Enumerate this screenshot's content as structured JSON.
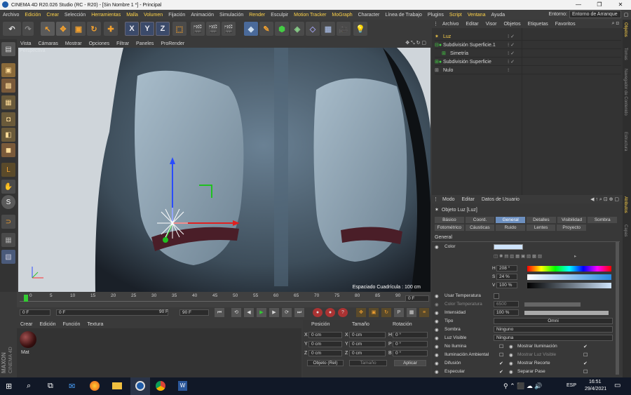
{
  "window": {
    "title": "CINEMA 4D R20.026 Studio (RC - R20) - [Sin Nombre 1 *] - Principal",
    "min": "—",
    "max": "❐",
    "close": "✕"
  },
  "menu": [
    "Archivo",
    "Edición",
    "Crear",
    "Selección",
    "Herramientas",
    "Malla",
    "Volumen",
    "Fijación",
    "Animación",
    "Simulación",
    "Render",
    "Esculpir",
    "Motion Tracker",
    "MoGraph",
    "Character",
    "Línea de Trabajo",
    "Plugins",
    "Script",
    "Ventana",
    "Ayuda"
  ],
  "environment": {
    "label": "Entorno:",
    "value": "Entorno de Arranque"
  },
  "viewport": {
    "menu": [
      "Vista",
      "Cámaras",
      "Mostrar",
      "Opciones",
      "Filtrar",
      "Paneles",
      "ProRender"
    ],
    "label": "Perspectiva",
    "grid_spacing": "Espaciado Cuadrícula : 100 cm"
  },
  "timeline": {
    "ticks": [
      "0",
      "5",
      "10",
      "15",
      "20",
      "25",
      "30",
      "35",
      "40",
      "45",
      "50",
      "55",
      "60",
      "65",
      "70",
      "75",
      "80",
      "85",
      "90"
    ],
    "end_frame": "0 F",
    "current_frame": "0 F",
    "start_field": "0 F",
    "range_end": "90 F",
    "max_frame": "90 F"
  },
  "materials": {
    "menu": [
      "Crear",
      "Edición",
      "Función",
      "Textura"
    ],
    "items": [
      {
        "name": "Mat"
      }
    ]
  },
  "coords": {
    "headers": [
      "Posición",
      "Tamaño",
      "Rotación"
    ],
    "rows": [
      {
        "a": "X",
        "pos": "0 cm",
        "b": "X",
        "size": "0 cm",
        "c": "H",
        "rot": "0 °"
      },
      {
        "a": "Y",
        "pos": "0 cm",
        "b": "Y",
        "size": "0 cm",
        "c": "P",
        "rot": "0 °"
      },
      {
        "a": "Z",
        "pos": "0 cm",
        "b": "Z",
        "size": "0 cm",
        "c": "B",
        "rot": "0 °"
      }
    ],
    "mode": "Objeto (Rel)",
    "size_mode": "Tamaño",
    "apply": "Aplicar"
  },
  "objects": {
    "menu": [
      "Archivo",
      "Editar",
      "Visor",
      "Objetos",
      "Etiquetas",
      "Favoritos"
    ],
    "items": [
      "Luz",
      "Subdivisión Superficie.1",
      "Simetría",
      "Subdivisión Superficie",
      "Nulo"
    ]
  },
  "attributes": {
    "menu": [
      "Modo",
      "Editar",
      "Datos de Usuario"
    ],
    "object_title": "Objeto Luz [Luz]",
    "tabs1": [
      "Básico",
      "Coord.",
      "General",
      "Detalles",
      "Visibilidad",
      "Sombra"
    ],
    "tabs2": [
      "Fotométrico",
      "Cáusticas",
      "Ruido",
      "Lentes",
      "Proyecto"
    ],
    "section": "General",
    "color_label": "Color",
    "hsv": [
      {
        "k": "H",
        "v": "208 °"
      },
      {
        "k": "S",
        "v": "24 %"
      },
      {
        "k": "V",
        "v": "100 %"
      }
    ],
    "use_temp": "Usar Temperatura",
    "color_temp": {
      "label": "Color Temperatura",
      "value": "6500"
    },
    "intensity": {
      "label": "Intensidad",
      "value": "100 %"
    },
    "type": {
      "label": "Tipo",
      "value": "Omni"
    },
    "shadow": {
      "label": "Sombra",
      "value": "Ninguno"
    },
    "visible_light": {
      "label": "Luz Visible",
      "value": "Ninguna"
    },
    "checks_left": [
      "No Ilumina",
      "Iluminación Ambiental",
      "Difusión",
      "Especular"
    ],
    "checks_right": [
      "Mostrar Iluminación",
      "Mostrar Luz Visible",
      "Mostrar Recorte",
      "Separar Pase"
    ]
  },
  "right_tabs": [
    "Objetos",
    "Tomas",
    "Navegador de Contenido",
    "Estructura",
    "Atributos",
    "Capas"
  ],
  "taskbar": {
    "time": "16:51",
    "date": "29/4/2021",
    "lang": "ESP"
  },
  "colors": {
    "accent": "#6c8fbf",
    "highlight": "#ffd34a",
    "light_color": "#cfe4fb"
  }
}
